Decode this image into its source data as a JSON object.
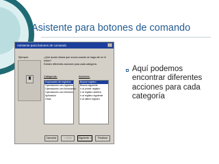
{
  "slide": {
    "title": "Asistente para botones de comando",
    "bullet": "Aquí podemos encontrar diferentes acciones para cada categoría"
  },
  "dialog": {
    "title": "Asistente para botones de comando",
    "close_glyph": "×",
    "sample_label": "Ejemplo:",
    "sample_icon_glyph": "♜",
    "question": "¿Qué acción desea que ocurra cuando se haga clic en el botón?",
    "hint": "Existen diferentes acciones para cada categoría.",
    "categories_label": "Categorías:",
    "actions_label": "Acciones:",
    "categories": [
      "Exploración de registros",
      "Operaciones con registros",
      "Operaciones con formularios",
      "Operaciones con informes",
      "Aplicación",
      "Otras"
    ],
    "selected_category_index": 0,
    "actions": [
      "Buscar registro",
      "Buscar siguiente",
      "Ir al primer registro",
      "Ir al registro anterior",
      "Ir al registro siguiente",
      "Ir al último registro"
    ],
    "selected_action_index": 0,
    "buttons": {
      "cancel": "Cancelar",
      "back": "< Atrás",
      "next": "Siguiente >",
      "finish": "Finalizar"
    }
  },
  "colors": {
    "title": "#235b8f",
    "dialog_titlebar": "#1b3f9a",
    "selection": "#1b3f9a",
    "deco_teal": "#1f6b73"
  }
}
